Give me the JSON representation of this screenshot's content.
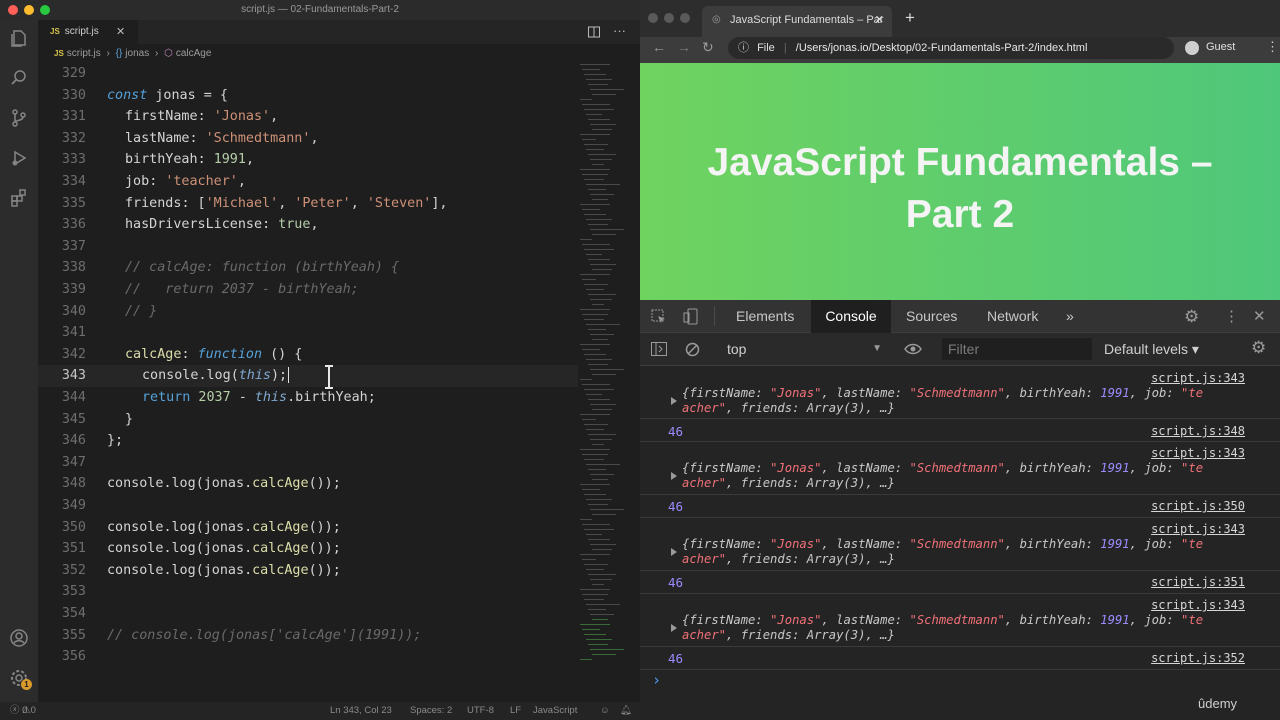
{
  "editor": {
    "window_title": "script.js — 02-Fundamentals-Part-2",
    "tab": {
      "badge": "JS",
      "label": "script.js",
      "close": "✕"
    },
    "breadcrumb": [
      "script.js",
      "›",
      "jonas",
      "›",
      "calcAge"
    ],
    "status": {
      "errors": "0",
      "warnings": "0",
      "position": "Ln 343, Col 23",
      "spaces": "Spaces: 2",
      "encoding": "UTF-8",
      "eol": "LF",
      "language": "JavaScript"
    },
    "notification_badge": "1"
  },
  "code_lines": [
    {
      "n": "329"
    },
    {
      "n": "330"
    },
    {
      "n": "331"
    },
    {
      "n": "332"
    },
    {
      "n": "333"
    },
    {
      "n": "334"
    },
    {
      "n": "335"
    },
    {
      "n": "336"
    },
    {
      "n": "337"
    },
    {
      "n": "338"
    },
    {
      "n": "339"
    },
    {
      "n": "340"
    },
    {
      "n": "341"
    },
    {
      "n": "342"
    },
    {
      "n": "343"
    },
    {
      "n": "344"
    },
    {
      "n": "345"
    },
    {
      "n": "346"
    },
    {
      "n": "347"
    },
    {
      "n": "348"
    },
    {
      "n": "349"
    },
    {
      "n": "350"
    },
    {
      "n": "351"
    },
    {
      "n": "352"
    },
    {
      "n": "353"
    },
    {
      "n": "354"
    },
    {
      "n": "355"
    },
    {
      "n": "356"
    }
  ],
  "code": {
    "l330": {
      "kw": "const",
      "name": " jonas = {"
    },
    "l331": {
      "prop": "firstName",
      "sep": ": ",
      "val": "'Jonas'",
      "end": ","
    },
    "l332": {
      "prop": "lastName",
      "sep": ": ",
      "val": "'Schmedtmann'",
      "end": ","
    },
    "l333": {
      "prop": "birthYeah",
      "sep": ": ",
      "val": "1991",
      "end": ","
    },
    "l334": {
      "prop": "job",
      "sep": ": ",
      "val": "'teacher'",
      "end": ","
    },
    "l335": {
      "prop": "friends",
      "sep": ": [",
      "v1": "'Michael'",
      "v2": "'Peter'",
      "v3": "'Steven'",
      "end": "],"
    },
    "l336": {
      "prop": "hasDriversLicense",
      "sep": ": ",
      "val": "true",
      "end": ","
    },
    "l338": "// calcAge: function (birthYeah) {",
    "l339": "//   return 2037 - birthYeah;",
    "l340": "// }",
    "l342": {
      "prop": "calcAge",
      "sep": ": ",
      "kw": "function",
      "end": " () {"
    },
    "l343": {
      "obj": "console",
      "dot": ".",
      "fn": "log",
      "open": "(",
      "arg": "this",
      "close": ");"
    },
    "l344": {
      "kw": "return",
      "num": " 2037",
      "op": " - ",
      "this": "this",
      "rest": ".birthYeah;"
    },
    "l345": "}",
    "l346": "};",
    "l348": {
      "obj": "console",
      "fn": "log",
      "arg": "jonas",
      "m": "calcAge",
      "end": "());"
    },
    "l350": {
      "obj": "console",
      "fn": "log",
      "arg": "jonas",
      "m": "calcAge",
      "end": "());"
    },
    "l351": {
      "obj": "console",
      "fn": "log",
      "arg": "jonas",
      "m": "calcAge",
      "end": "());"
    },
    "l352": {
      "obj": "console",
      "fn": "log",
      "arg": "jonas",
      "m": "calcAge",
      "end": "());"
    },
    "l355": "// console.log(jonas['calcAge'](1991));"
  },
  "browser": {
    "tab_title": "JavaScript Fundamentals – Par",
    "new_tab": "+",
    "tab_close": "✕",
    "scheme": "File",
    "url": "/Users/jonas.io/Desktop/02-Fundamentals-Part-2/index.html",
    "profile": "Guest",
    "page_heading": "JavaScript Fundamentals – Part 2",
    "page_color_start": "#6fd35f",
    "page_color_end": "#4fc77a"
  },
  "devtools": {
    "tabs": [
      "Elements",
      "Console",
      "Sources",
      "Network",
      "»"
    ],
    "active_tab": "Console",
    "context": "top",
    "filter_placeholder": "Filter",
    "levels": "Default levels ▾",
    "entries": [
      {
        "src": "script.js:343",
        "l1": "{firstName: ",
        "l1s": "\"Jonas\"",
        "l1b": ", lastName: ",
        "l1c": "\"Schmedtmann\"",
        "l1d": ", birthYeah: ",
        "l1e": "1991",
        "l1f": ", job: ",
        "l1g": "\"te",
        "l2a": "acher\"",
        "l2b": ", friends: Array(3), …}"
      },
      {
        "src": "script.js:348",
        "num": "46"
      },
      {
        "src": "script.js:343",
        "l1": "{firstName: ",
        "l1s": "\"Jonas\"",
        "l1b": ", lastName: ",
        "l1c": "\"Schmedtmann\"",
        "l1d": ", birthYeah: ",
        "l1e": "1991",
        "l1f": ", job: ",
        "l1g": "\"te",
        "l2a": "acher\"",
        "l2b": ", friends: Array(3), …}"
      },
      {
        "src": "script.js:350",
        "num": "46"
      },
      {
        "src": "script.js:343",
        "l1": "{firstName: ",
        "l1s": "\"Jonas\"",
        "l1b": ", lastName: ",
        "l1c": "\"Schmedtmann\"",
        "l1d": ", birthYeah: ",
        "l1e": "1991",
        "l1f": ", job: ",
        "l1g": "\"te",
        "l2a": "acher\"",
        "l2b": ", friends: Array(3), …}"
      },
      {
        "src": "script.js:351",
        "num": "46"
      },
      {
        "src": "script.js:343",
        "l1": "{firstName: ",
        "l1s": "\"Jonas\"",
        "l1b": ", lastName: ",
        "l1c": "\"Schmedtmann\"",
        "l1d": ", birthYeah: ",
        "l1e": "1991",
        "l1f": ", job: ",
        "l1g": "\"te",
        "l2a": "acher\"",
        "l2b": ", friends: Array(3), …}"
      },
      {
        "src": "script.js:352",
        "num": "46"
      }
    ],
    "prompt": "›"
  },
  "watermark": "ûdemy"
}
